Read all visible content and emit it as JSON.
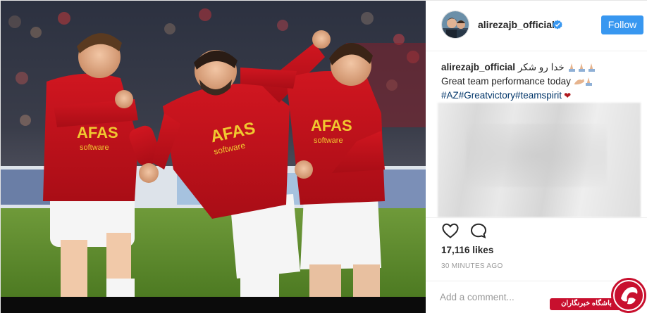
{
  "post": {
    "photo": {
      "players": [
        {
          "sponsor": "AFAS",
          "sponsor_sub": "software"
        },
        {
          "sponsor": "AFAS",
          "sponsor_sub": "software"
        },
        {
          "sponsor": "AFAS",
          "sponsor_sub": "software"
        }
      ]
    },
    "header": {
      "username": "alirezajb_official",
      "follow_label": "Follow",
      "verified_icon": "verified-badge-icon",
      "colors": {
        "follow_bg": "#3897f0",
        "verified": "#3897f0"
      }
    },
    "caption": {
      "username": "alirezajb_official",
      "persian_text": "خدا رو شکر",
      "line2": "Great team performance today",
      "hashtags": "#AZ#Greatvictory#teamspirit",
      "heart_icon": "heart-icon"
    },
    "actions": {
      "like_icon": "heart-outline-icon",
      "comment_icon": "comment-bubble-icon"
    },
    "likes": "17,116 likes",
    "time": "30 MINUTES AGO",
    "comment": {
      "placeholder": "Add a comment..."
    },
    "watermark": {
      "text": "باشگاه خبرنگاران",
      "color": "#c8102e"
    }
  }
}
